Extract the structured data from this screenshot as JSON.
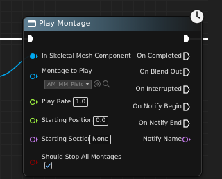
{
  "node": {
    "title": "Play Montage",
    "accent": "#5f7f93"
  },
  "inputs": {
    "skeletal_mesh": {
      "label": "In Skeletal Mesh Component"
    },
    "montage": {
      "label": "Montage to Play",
      "value": "AM_MM_Pistol_"
    },
    "play_rate": {
      "label": "Play Rate",
      "value": "1.0"
    },
    "starting_position": {
      "label": "Starting Position",
      "value": "0.0"
    },
    "starting_section": {
      "label": "Starting Section",
      "value": "None"
    },
    "stop_all": {
      "label": "Should Stop All Montages",
      "checked": true
    }
  },
  "outputs": {
    "on_completed": "On Completed",
    "on_blend_out": "On Blend Out",
    "on_interrupted": "On Interrupted",
    "on_notify_begin": "On Notify Begin",
    "on_notify_end": "On Notify End",
    "notify_name": "Notify Name"
  },
  "colors": {
    "object_pin": "#00a8f0",
    "float_pin": "#9bef3f",
    "name_pin": "#c87bf0",
    "bool_pin": "#8c0000",
    "exec_pin": "#ffffff"
  }
}
